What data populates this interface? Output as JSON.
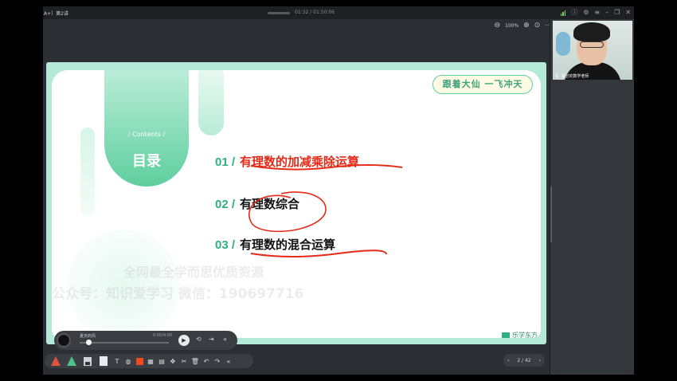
{
  "window": {
    "title": "A+）第2讲",
    "timecode": "01:32 / 01:50:06"
  },
  "view_toolbar": {
    "zoom_out_icon": "minus-circle-icon",
    "zoom": "100%",
    "zoom_in_icon": "plus-circle-icon",
    "fit_icon": "target-icon",
    "more": "···"
  },
  "slide": {
    "contents_label": "/ Contents /",
    "title": "目录",
    "badge": "跟着大仙 一飞冲天",
    "items": [
      {
        "num": "01 /",
        "text": "有理数的加减乘除运算"
      },
      {
        "num": "02 /",
        "text": "有理数综合"
      },
      {
        "num": "03 /",
        "text": "有理数的混合运算"
      }
    ],
    "brand": "乐学东方",
    "watermark_1": "全网最全学而思优质资源",
    "watermark_2": "公众号：知识爱学习  微信：190697716",
    "colors": {
      "accent": "#2fae84",
      "highlight": "#e52a17",
      "frame": "#b6ead8"
    }
  },
  "player": {
    "song": "夏天的风",
    "time": "0:00/4:00",
    "play_icon": "play-icon",
    "loop_icon": "loop-icon",
    "exit_icon": "exit-icon",
    "collapse": "«"
  },
  "toolbar": {
    "icons": [
      "cone-red-icon",
      "cone-green-icon",
      "battery-icon",
      "doc-icon",
      "text-tool-icon",
      "fill-icon",
      "color-swatch-icon",
      "image-icon",
      "table-icon",
      "move-icon",
      "scissors-icon",
      "trash-icon",
      "undo-icon",
      "redo-icon",
      "collapse-icon"
    ]
  },
  "pager": {
    "prev": "‹",
    "page": "2 / 42",
    "next": "›"
  },
  "sidebar": {
    "video_caption": "凌空的数学老师"
  }
}
